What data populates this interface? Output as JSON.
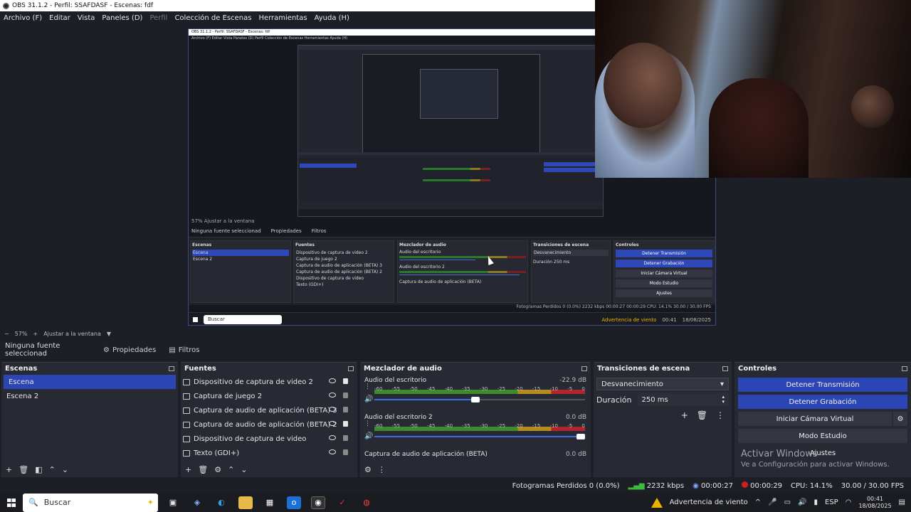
{
  "window": {
    "title": "OBS 31.1.2 - Perfil: SSAFDASF - Escenas: fdf"
  },
  "menu": {
    "items": [
      "Archivo (F)",
      "Editar",
      "Vista",
      "Paneles (D)",
      "Perfil",
      "Colección de Escenas",
      "Herramientas",
      "Ayuda (H)"
    ]
  },
  "zoom": {
    "minus": "−",
    "value": "57%",
    "plus": "+",
    "fit": "Ajustar a la ventana",
    "arrow": "▼"
  },
  "source_bar": {
    "label": "Ninguna fuente seleccionad",
    "properties": "Propiedades",
    "filters": "Filtros"
  },
  "scenes": {
    "title": "Escenas",
    "items": [
      "Escena",
      "Escena 2"
    ]
  },
  "sources": {
    "title": "Fuentes",
    "items": [
      "Dispositivo de captura de video 2",
      "Captura de juego 2",
      "Captura de audio de aplicación (BETA) 3",
      "Captura de audio de aplicación (BETA) 2",
      "Dispositivo de captura de video",
      "Texto (GDI+)"
    ]
  },
  "mixer": {
    "title": "Mezclador de audio",
    "ticks": [
      "-60",
      "-55",
      "-50",
      "-45",
      "-40",
      "-35",
      "-30",
      "-25",
      "-20",
      "-15",
      "-10",
      "-5",
      "0"
    ],
    "tracks": [
      {
        "name": "Audio del escritorio",
        "db": "-22.9 dB",
        "volume": 0.5
      },
      {
        "name": "Audio del escritorio 2",
        "db": "0.0 dB",
        "volume": 1.0
      },
      {
        "name": "Captura de audio de aplicación (BETA)",
        "db": "0.0 dB"
      }
    ]
  },
  "transitions": {
    "title": "Transiciones de escena",
    "selected": "Desvanecimiento",
    "duration_label": "Duración",
    "duration_value": "250 ms"
  },
  "controls": {
    "title": "Controles",
    "stop_stream": "Detener Transmisión",
    "stop_record": "Detener Grabación",
    "virtual_cam": "Iniciar Cámara Virtual",
    "studio_mode": "Modo Estudio",
    "settings": "Ajustes"
  },
  "activation": {
    "title": "Activar Windows",
    "subtitle": "Ve a Configuración para activar Windows."
  },
  "status": {
    "dropped": "Fotogramas Perdidos 0 (0.0%)",
    "bitrate": "2232 kbps",
    "stream_time": "00:00:27",
    "rec_time": "00:00:29",
    "cpu": "CPU: 14.1%",
    "fps": "30.00 / 30.00 FPS"
  },
  "taskbar": {
    "search": "Buscar",
    "weather": "Advertencia de viento",
    "lang": "ESP",
    "time": "00:41",
    "date": "18/08/2025"
  },
  "nested": {
    "title": "OBS 31.1.2 - Perfil: SSAFDASF - Escenas: fdf",
    "menu": "Archivo (F)  Editar  Vista  Paneles (D)  Perfil  Colección de Escenas  Herramientas  Ayuda (H)",
    "zoom": "57%   Ajustar a la ventana",
    "srcbar": "Ninguna fuente seleccionad",
    "props": "Propiedades",
    "filters": "Filtros",
    "scenes": "Escenas",
    "scene1": "Escena",
    "scene2": "Escena 2",
    "sources": "Fuentes",
    "src1": "Dispositivo de captura de video 2",
    "src2": "Captura de juego 2",
    "src3": "Captura de audio de aplicación (BETA) 3",
    "src4": "Captura de audio de aplicación (BETA) 2",
    "src5": "Dispositivo de captura de video",
    "src6": "Texto (GDI+)",
    "mixer": "Mezclador de audio",
    "trk1": "Audio del escritorio",
    "trk2": "Audio del escritorio 2",
    "trk3": "Captura de audio de aplicación (BETA)",
    "trans": "Transiciones de escena",
    "fade": "Desvanecimiento",
    "dur": "Duración   250 ms",
    "controls": "Controles",
    "b1": "Detener Transmisión",
    "b2": "Detener Grabación",
    "b3": "Iniciar Cámara Virtual",
    "b4": "Modo Estudio",
    "b5": "Ajustes",
    "status": "Fotogramas Perdidos 0 (0.0%)   2232 kbps   00:00:27   00:00:29   CPU: 14.1%   30.00 / 30.00 FPS",
    "search": "Buscar",
    "weather": "Advertencia de viento",
    "time": "00:41",
    "date": "18/08/2025"
  }
}
